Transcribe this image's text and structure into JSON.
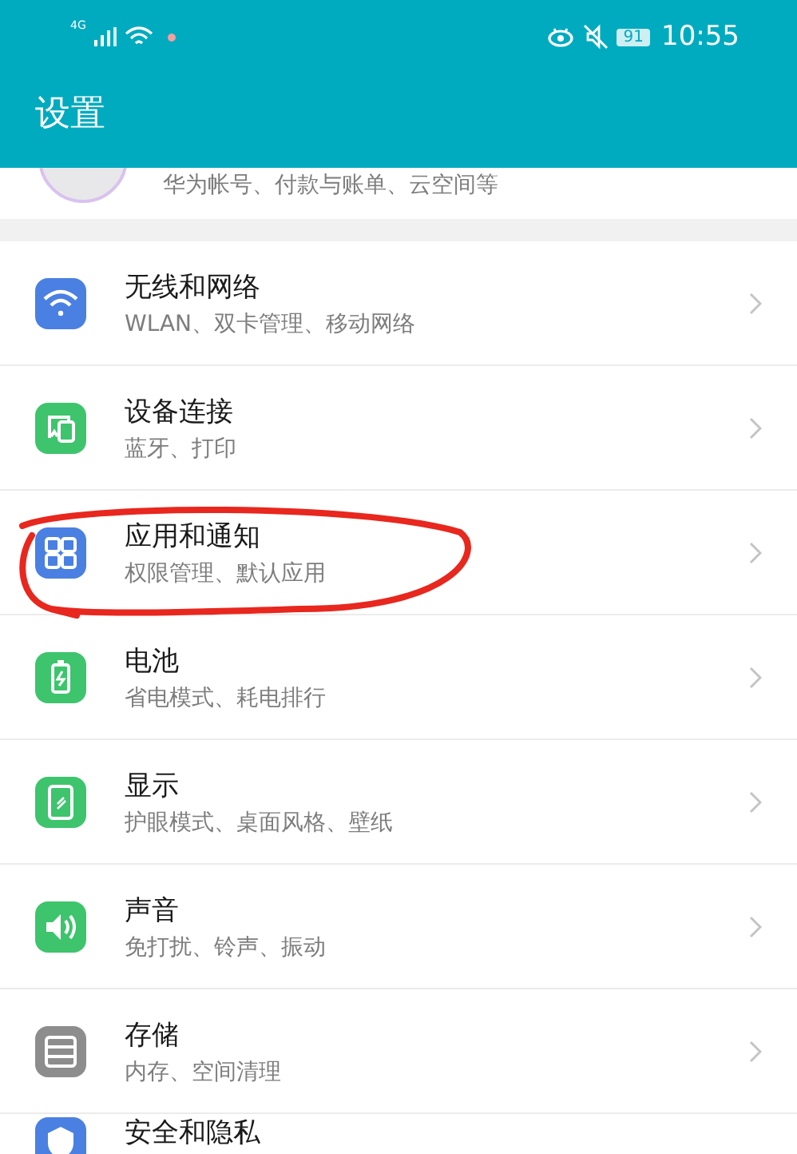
{
  "status_bar": {
    "network": "4G",
    "battery": "91",
    "time": "10:55"
  },
  "header": {
    "title": "设置"
  },
  "account": {
    "subtitle": "华为帐号、付款与账单、云空间等"
  },
  "items": [
    {
      "kind": "wifi",
      "color": "#4a80e2",
      "title": "无线和网络",
      "subtitle": "WLAN、双卡管理、移动网络",
      "circled": false
    },
    {
      "kind": "devices",
      "color": "#3ec46d",
      "title": "设备连接",
      "subtitle": "蓝牙、打印",
      "circled": false
    },
    {
      "kind": "apps",
      "color": "#4a80e2",
      "title": "应用和通知",
      "subtitle": "权限管理、默认应用",
      "circled": true
    },
    {
      "kind": "battery",
      "color": "#3ec46d",
      "title": "电池",
      "subtitle": "省电模式、耗电排行",
      "circled": false
    },
    {
      "kind": "display",
      "color": "#3ec46d",
      "title": "显示",
      "subtitle": "护眼模式、桌面风格、壁纸",
      "circled": false
    },
    {
      "kind": "sound",
      "color": "#3ec46d",
      "title": "声音",
      "subtitle": "免打扰、铃声、振动",
      "circled": false
    },
    {
      "kind": "storage",
      "color": "#8d8d8d",
      "title": "存储",
      "subtitle": "内存、空间清理",
      "circled": false
    },
    {
      "kind": "security",
      "color": "#4a80e2",
      "title": "安全和隐私",
      "circled": false
    }
  ]
}
